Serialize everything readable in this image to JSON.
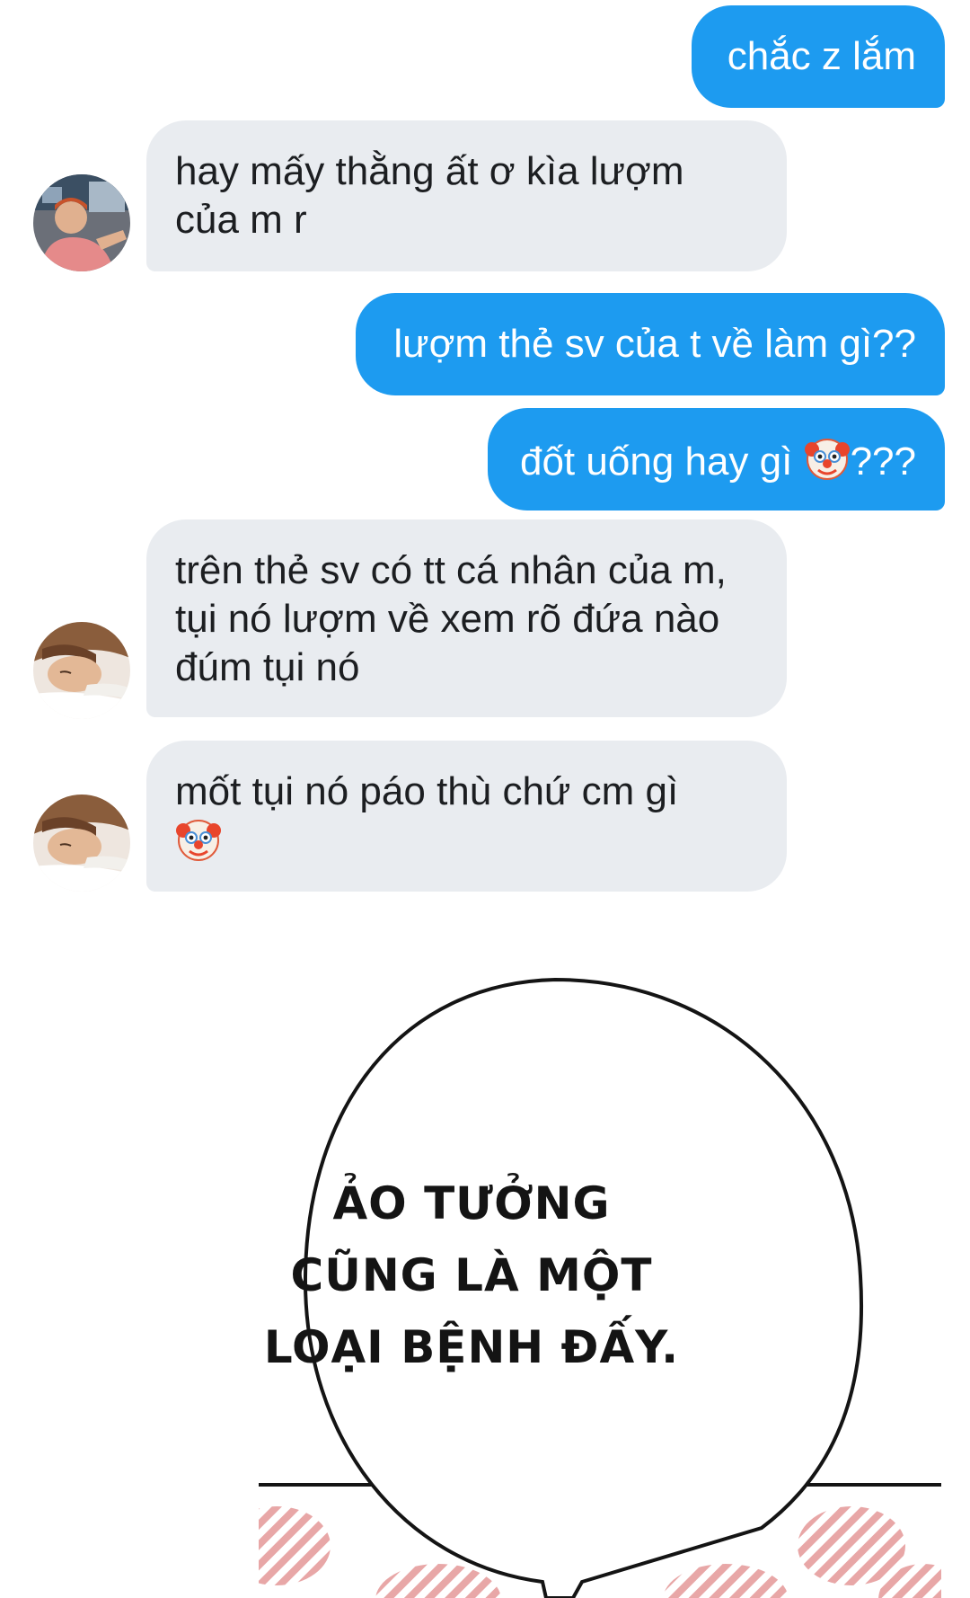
{
  "messages": [
    {
      "dir": "sent",
      "lines": [
        "chắc z lắm"
      ]
    },
    {
      "dir": "received",
      "avatar": "red-shirt-avatar",
      "lines": [
        "hay mấy thằng ất ơ kìa lượm",
        "của m r"
      ]
    },
    {
      "dir": "sent",
      "lines": [
        "lượm thẻ sv của t về làm gì??"
      ]
    },
    {
      "dir": "sent",
      "lines": [
        "đốt uống hay gì",
        "???"
      ],
      "emoji": "clown-face-icon"
    },
    {
      "dir": "received",
      "avatar": "sleeping-avatar",
      "lines": [
        "trên thẻ sv có tt cá nhân của m,",
        "tụi nó lượm về xem rõ đứa nào",
        "đúm tụi nó"
      ]
    },
    {
      "dir": "received",
      "avatar": "sleeping-avatar",
      "lines": [
        "mốt tụi nó páo thù chứ cm gì"
      ],
      "emoji": "clown-face-icon"
    }
  ],
  "meme": {
    "lines": [
      "ẢO TƯỞNG",
      "CŨNG LÀ MỘT",
      "LOẠI BỆNH ĐẤY."
    ]
  },
  "colors": {
    "sent_bubble": "#1d9bf0",
    "received_bubble": "#e9ecf0",
    "meme_pattern": "#e8a7a7"
  }
}
